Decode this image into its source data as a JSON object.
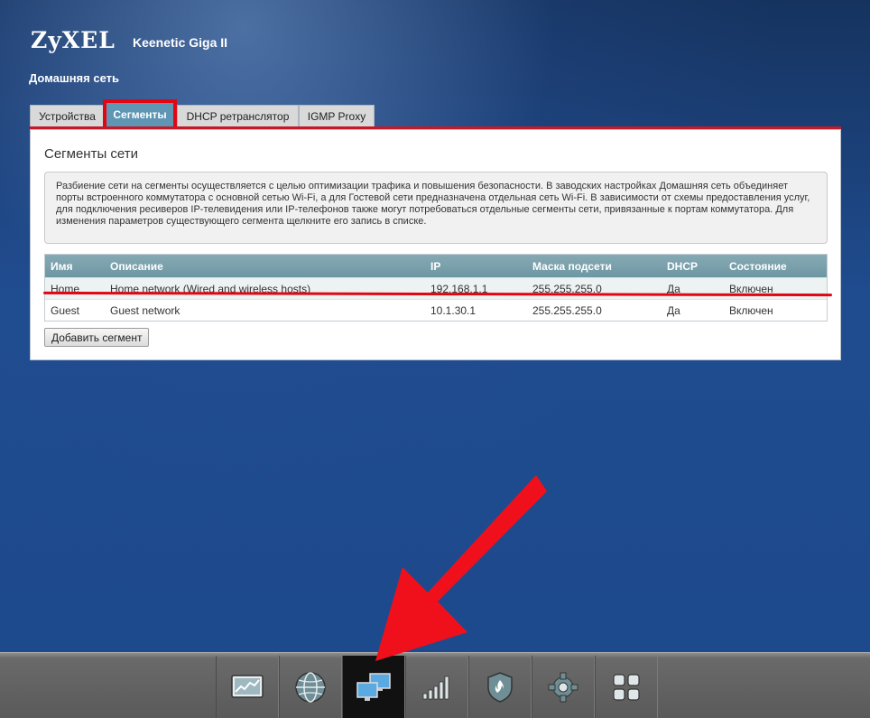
{
  "header": {
    "brand": "ZyXEL",
    "model": "Keenetic Giga II",
    "section_title": "Домашняя сеть"
  },
  "tabs": [
    {
      "label": "Устройства",
      "active": false
    },
    {
      "label": "Сегменты",
      "active": true
    },
    {
      "label": "DHCP ретранслятор",
      "active": false
    },
    {
      "label": "IGMP Proxy",
      "active": false
    }
  ],
  "panel": {
    "title": "Сегменты сети",
    "info": "Разбиение сети на сегменты осуществляется с целью оптимизации трафика и повышения безопасности. В заводских настройках Домашняя сеть объединяет порты встроенного коммутатора с основной сетью Wi-Fi, а для Гостевой сети предназначена отдельная сеть Wi-Fi. В зависимости от схемы предоставления услуг, для подключения ресиверов IP-телевидения или IP-телефонов также могут потребоваться отдельные сегменты сети, привязанные к портам коммутатора. Для изменения параметров существующего сегмента щелкните его запись в списке.",
    "add_button": "Добавить сегмент"
  },
  "table": {
    "columns": [
      "Имя",
      "Описание",
      "IP",
      "Маска подсети",
      "DHCP",
      "Состояние"
    ],
    "rows": [
      [
        "Home",
        "Home network (Wired and wireless hosts)",
        "192.168.1.1",
        "255.255.255.0",
        "Да",
        "Включен"
      ],
      [
        "Guest",
        "Guest network",
        "10.1.30.1",
        "255.255.255.0",
        "Да",
        "Включен"
      ]
    ]
  },
  "nav": [
    {
      "icon": "monitor-chart-icon",
      "active": false
    },
    {
      "icon": "globe-icon",
      "active": false
    },
    {
      "icon": "home-network-icon",
      "active": true
    },
    {
      "icon": "signal-bars-icon",
      "active": false
    },
    {
      "icon": "shield-flame-icon",
      "active": false
    },
    {
      "icon": "gear-icon",
      "active": false
    },
    {
      "icon": "apps-grid-icon",
      "active": false
    }
  ],
  "colors": {
    "accent": "#5f96b3",
    "highlight": "#e20613",
    "background": "#1f4c8f"
  }
}
